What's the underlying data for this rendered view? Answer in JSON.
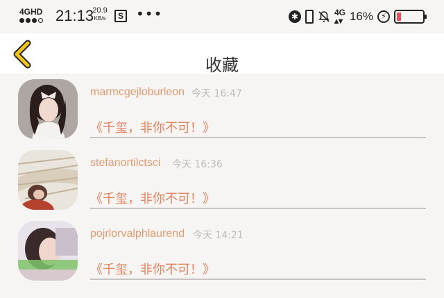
{
  "status_bar": {
    "network_label": "4GHD",
    "time": "21:13",
    "speed_value": "20.9",
    "speed_unit": "KB/s",
    "s_badge": "S",
    "more": "•••",
    "bt_glyph": "✱",
    "sig_label": "4G",
    "battery_percent": "16%",
    "battery_level": 0.16,
    "battery_color": "#e7505c"
  },
  "header": {
    "title": "收藏",
    "back_color": "#f0c419"
  },
  "favorites": [
    {
      "user": "marmcgejloburleon",
      "time": "今天 16:47",
      "message": "《千玺，非你不可！》"
    },
    {
      "user": "stefanortilctsci",
      "time": "今天 16:36",
      "message": "《千玺，非你不可！》"
    },
    {
      "user": "pojrlorvalphlaurend",
      "time": "今天 14:21",
      "message": "《千玺，非你不可！》"
    }
  ],
  "colors": {
    "username": "#e29a6f",
    "message": "#e2835f",
    "time": "#bbbbbb"
  }
}
